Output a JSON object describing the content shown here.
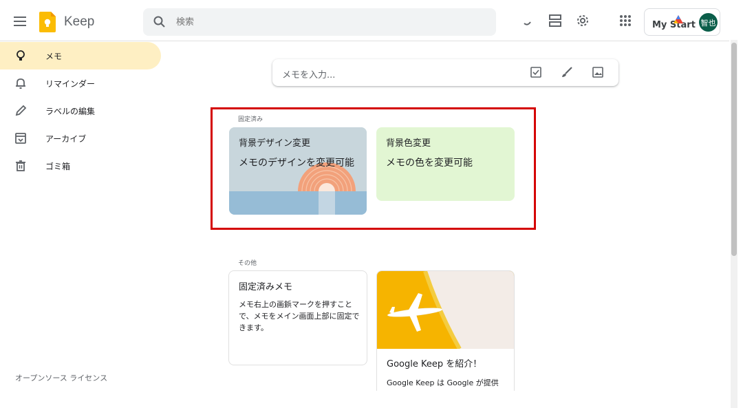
{
  "header": {
    "app_name": "Keep",
    "search_placeholder": "検索",
    "mystart_label": "My Start",
    "avatar_initials": "智也"
  },
  "sidebar": {
    "items": [
      {
        "label": "メモ",
        "icon": "lightbulb-icon",
        "active": true
      },
      {
        "label": "リマインダー",
        "icon": "bell-icon"
      },
      {
        "label": "ラベルの編集",
        "icon": "pencil-icon"
      },
      {
        "label": "アーカイブ",
        "icon": "archive-icon"
      },
      {
        "label": "ゴミ箱",
        "icon": "trash-icon"
      }
    ],
    "footer": "オープンソース ライセンス"
  },
  "take_note": {
    "placeholder": "メモを入力..."
  },
  "pinned": {
    "heading": "固定済み",
    "notes": [
      {
        "title": "背景デザイン変更",
        "body": "メモのデザインを変更可能"
      },
      {
        "title": "背景色変更",
        "body": "メモの色を変更可能"
      }
    ]
  },
  "others": {
    "heading": "その他",
    "notes": [
      {
        "title": "固定済みメモ",
        "body": "メモ右上の画鋲マークを押すことで、メモをメイン画面上部に固定できます。"
      },
      {
        "title": "Google Keep を紹介！",
        "body": "Google Keep は Google が提供"
      }
    ]
  },
  "colors": {
    "accent_yellow": "#feefc3",
    "note_green": "#e2f6d3",
    "highlight_red": "#d40000"
  }
}
